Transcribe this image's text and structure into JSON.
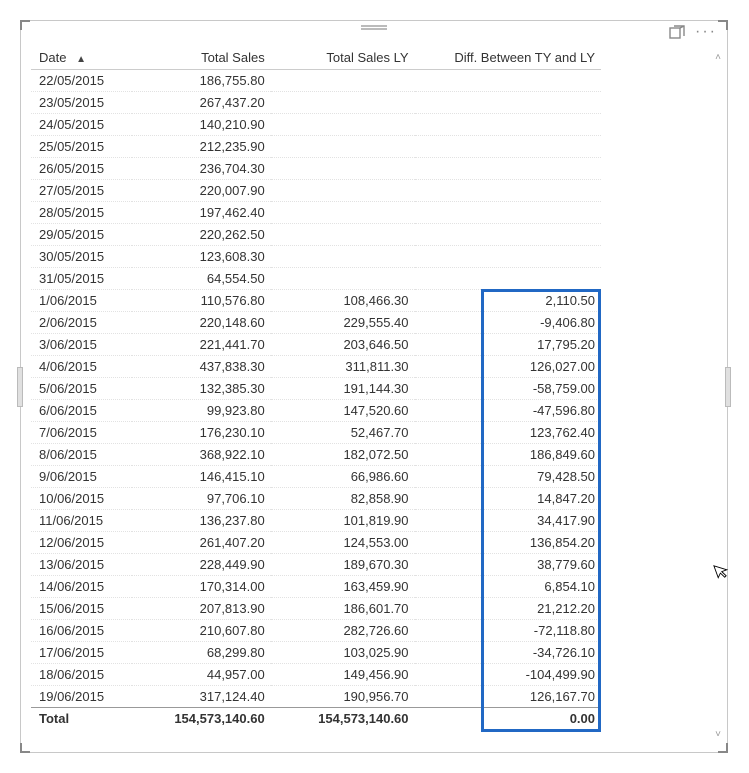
{
  "columns": {
    "date": "Date",
    "total_sales": "Total Sales",
    "total_sales_ly": "Total Sales LY",
    "diff": "Diff. Between TY and LY"
  },
  "sort_indicator": "▲",
  "rows": [
    {
      "date": "22/05/2015",
      "ts": "186,755.80",
      "ly": "",
      "diff": ""
    },
    {
      "date": "23/05/2015",
      "ts": "267,437.20",
      "ly": "",
      "diff": ""
    },
    {
      "date": "24/05/2015",
      "ts": "140,210.90",
      "ly": "",
      "diff": ""
    },
    {
      "date": "25/05/2015",
      "ts": "212,235.90",
      "ly": "",
      "diff": ""
    },
    {
      "date": "26/05/2015",
      "ts": "236,704.30",
      "ly": "",
      "diff": ""
    },
    {
      "date": "27/05/2015",
      "ts": "220,007.90",
      "ly": "",
      "diff": ""
    },
    {
      "date": "28/05/2015",
      "ts": "197,462.40",
      "ly": "",
      "diff": ""
    },
    {
      "date": "29/05/2015",
      "ts": "220,262.50",
      "ly": "",
      "diff": ""
    },
    {
      "date": "30/05/2015",
      "ts": "123,608.30",
      "ly": "",
      "diff": ""
    },
    {
      "date": "31/05/2015",
      "ts": "64,554.50",
      "ly": "",
      "diff": ""
    },
    {
      "date": "1/06/2015",
      "ts": "110,576.80",
      "ly": "108,466.30",
      "diff": "2,110.50"
    },
    {
      "date": "2/06/2015",
      "ts": "220,148.60",
      "ly": "229,555.40",
      "diff": "-9,406.80"
    },
    {
      "date": "3/06/2015",
      "ts": "221,441.70",
      "ly": "203,646.50",
      "diff": "17,795.20"
    },
    {
      "date": "4/06/2015",
      "ts": "437,838.30",
      "ly": "311,811.30",
      "diff": "126,027.00"
    },
    {
      "date": "5/06/2015",
      "ts": "132,385.30",
      "ly": "191,144.30",
      "diff": "-58,759.00"
    },
    {
      "date": "6/06/2015",
      "ts": "99,923.80",
      "ly": "147,520.60",
      "diff": "-47,596.80"
    },
    {
      "date": "7/06/2015",
      "ts": "176,230.10",
      "ly": "52,467.70",
      "diff": "123,762.40"
    },
    {
      "date": "8/06/2015",
      "ts": "368,922.10",
      "ly": "182,072.50",
      "diff": "186,849.60"
    },
    {
      "date": "9/06/2015",
      "ts": "146,415.10",
      "ly": "66,986.60",
      "diff": "79,428.50"
    },
    {
      "date": "10/06/2015",
      "ts": "97,706.10",
      "ly": "82,858.90",
      "diff": "14,847.20"
    },
    {
      "date": "11/06/2015",
      "ts": "136,237.80",
      "ly": "101,819.90",
      "diff": "34,417.90"
    },
    {
      "date": "12/06/2015",
      "ts": "261,407.20",
      "ly": "124,553.00",
      "diff": "136,854.20"
    },
    {
      "date": "13/06/2015",
      "ts": "228,449.90",
      "ly": "189,670.30",
      "diff": "38,779.60"
    },
    {
      "date": "14/06/2015",
      "ts": "170,314.00",
      "ly": "163,459.90",
      "diff": "6,854.10"
    },
    {
      "date": "15/06/2015",
      "ts": "207,813.90",
      "ly": "186,601.70",
      "diff": "21,212.20"
    },
    {
      "date": "16/06/2015",
      "ts": "210,607.80",
      "ly": "282,726.60",
      "diff": "-72,118.80"
    },
    {
      "date": "17/06/2015",
      "ts": "68,299.80",
      "ly": "103,025.90",
      "diff": "-34,726.10"
    },
    {
      "date": "18/06/2015",
      "ts": "44,957.00",
      "ly": "149,456.90",
      "diff": "-104,499.90"
    },
    {
      "date": "19/06/2015",
      "ts": "317,124.40",
      "ly": "190,956.70",
      "diff": "126,167.70"
    }
  ],
  "totals": {
    "label": "Total",
    "ts": "154,573,140.60",
    "ly": "154,573,140.60",
    "diff": "0.00"
  }
}
